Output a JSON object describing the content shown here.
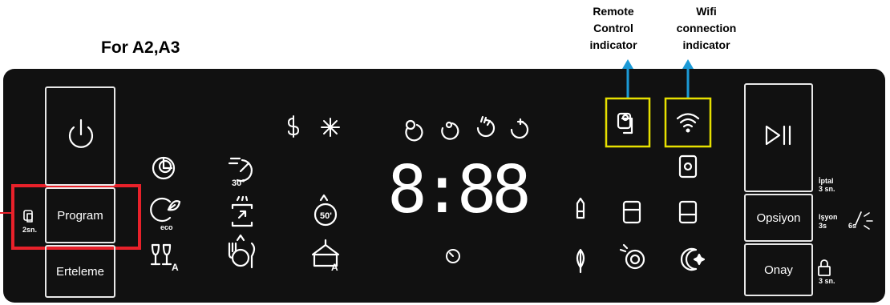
{
  "title": "For A2,A3",
  "callouts": {
    "remote": [
      "Remote",
      "Control",
      "indicator"
    ],
    "wifi": [
      "Wifi",
      "connection",
      "indicator"
    ]
  },
  "buttons": {
    "program": "Program",
    "erteleme": "Erteleme",
    "opsiyon": "Opsiyon",
    "onay": "Onay"
  },
  "display": {
    "time": "8:88"
  },
  "labels": {
    "temp_30": "30°",
    "temp_50": "50'",
    "eco": "eco",
    "a_mark": "A",
    "left_2sn": "2sn.",
    "iptal": "İptal",
    "iptal_3sn": "3 sn.",
    "isyon": "Işyon",
    "isyon_3s": "3s",
    "light_6s": "6s",
    "lock_3sn": "3 sn."
  },
  "colors": {
    "panel": "#111111",
    "highlight_red": "#e8212a",
    "highlight_yellow": "#e6e000",
    "arrow_blue": "#1c9ad6",
    "led": "#ffffff"
  }
}
